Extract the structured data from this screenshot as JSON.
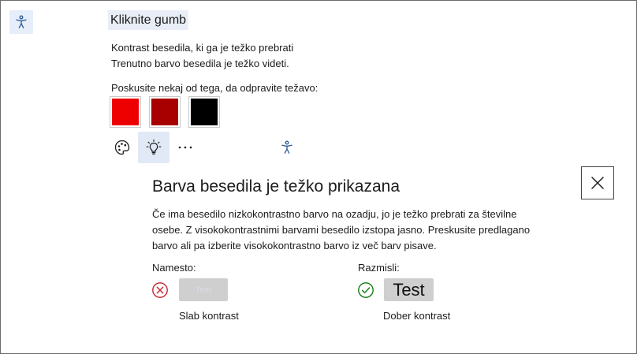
{
  "header": {
    "title": "Kliknite gumb",
    "accessibility_icon": "accessibility-person-icon"
  },
  "issue": {
    "line1": "Kontrast besedila, ki ga je težko prebrati",
    "line2": "Trenutno barvo besedila je težko videti.",
    "suggestion_prompt": "Poskusite nekaj od tega, da odpravite težavo:",
    "swatches": [
      {
        "name": "bright-red",
        "color": "#ee0000"
      },
      {
        "name": "dark-red",
        "color": "#a80000"
      },
      {
        "name": "black",
        "color": "#000000"
      }
    ]
  },
  "toolbar": {
    "icons": [
      "palette-icon",
      "lightbulb-icon",
      "more-icon",
      "accessibility-person-icon"
    ],
    "active": "lightbulb-icon"
  },
  "panel": {
    "title": "Barva besedila je težko prikazana",
    "description": "Če ima besedilo nizkokontrastno barvo na ozadju, jo je težko prebrati za številne osebe. Z visokokontrastnimi barvami besedilo izstopa jasno. Preskusite predlagano barvo ali pa izberite visokokontrastno barvo iz več barv pisave.",
    "close_icon": "close-icon",
    "instead_label": "Namesto:",
    "consider_label": "Razmisli:",
    "bad_sample_text": "Test",
    "good_sample_text": "Test",
    "bad_caption": "Slab kontrast",
    "good_caption": "Dober kontrast"
  },
  "colors": {
    "accent_bg": "#e1e9f6",
    "icon_blue": "#2b5797",
    "bad_red": "#c4262e",
    "good_green": "#107c10",
    "sample_bg": "#cfcfcf"
  }
}
